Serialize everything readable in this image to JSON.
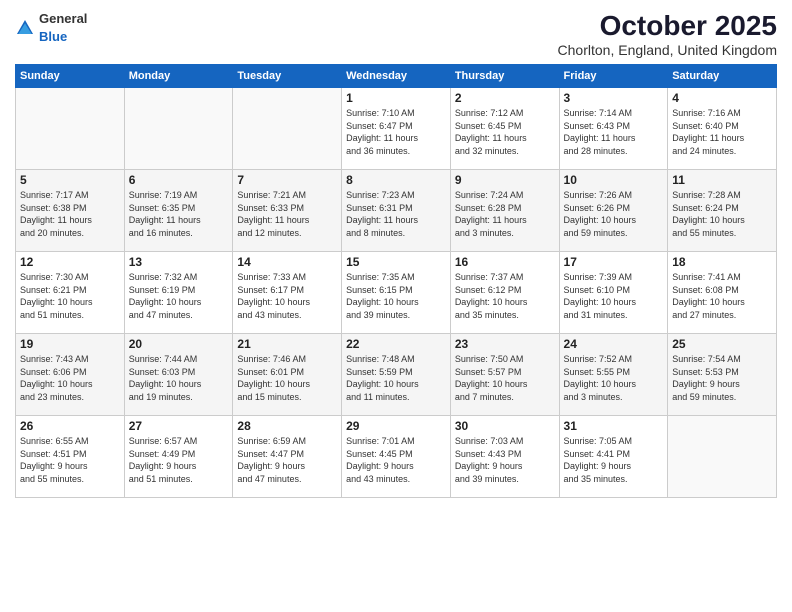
{
  "logo": {
    "general": "General",
    "blue": "Blue"
  },
  "header": {
    "month": "October 2025",
    "location": "Chorlton, England, United Kingdom"
  },
  "days_of_week": [
    "Sunday",
    "Monday",
    "Tuesday",
    "Wednesday",
    "Thursday",
    "Friday",
    "Saturday"
  ],
  "weeks": [
    [
      {
        "day": "",
        "info": ""
      },
      {
        "day": "",
        "info": ""
      },
      {
        "day": "",
        "info": ""
      },
      {
        "day": "1",
        "info": "Sunrise: 7:10 AM\nSunset: 6:47 PM\nDaylight: 11 hours\nand 36 minutes."
      },
      {
        "day": "2",
        "info": "Sunrise: 7:12 AM\nSunset: 6:45 PM\nDaylight: 11 hours\nand 32 minutes."
      },
      {
        "day": "3",
        "info": "Sunrise: 7:14 AM\nSunset: 6:43 PM\nDaylight: 11 hours\nand 28 minutes."
      },
      {
        "day": "4",
        "info": "Sunrise: 7:16 AM\nSunset: 6:40 PM\nDaylight: 11 hours\nand 24 minutes."
      }
    ],
    [
      {
        "day": "5",
        "info": "Sunrise: 7:17 AM\nSunset: 6:38 PM\nDaylight: 11 hours\nand 20 minutes."
      },
      {
        "day": "6",
        "info": "Sunrise: 7:19 AM\nSunset: 6:35 PM\nDaylight: 11 hours\nand 16 minutes."
      },
      {
        "day": "7",
        "info": "Sunrise: 7:21 AM\nSunset: 6:33 PM\nDaylight: 11 hours\nand 12 minutes."
      },
      {
        "day": "8",
        "info": "Sunrise: 7:23 AM\nSunset: 6:31 PM\nDaylight: 11 hours\nand 8 minutes."
      },
      {
        "day": "9",
        "info": "Sunrise: 7:24 AM\nSunset: 6:28 PM\nDaylight: 11 hours\nand 3 minutes."
      },
      {
        "day": "10",
        "info": "Sunrise: 7:26 AM\nSunset: 6:26 PM\nDaylight: 10 hours\nand 59 minutes."
      },
      {
        "day": "11",
        "info": "Sunrise: 7:28 AM\nSunset: 6:24 PM\nDaylight: 10 hours\nand 55 minutes."
      }
    ],
    [
      {
        "day": "12",
        "info": "Sunrise: 7:30 AM\nSunset: 6:21 PM\nDaylight: 10 hours\nand 51 minutes."
      },
      {
        "day": "13",
        "info": "Sunrise: 7:32 AM\nSunset: 6:19 PM\nDaylight: 10 hours\nand 47 minutes."
      },
      {
        "day": "14",
        "info": "Sunrise: 7:33 AM\nSunset: 6:17 PM\nDaylight: 10 hours\nand 43 minutes."
      },
      {
        "day": "15",
        "info": "Sunrise: 7:35 AM\nSunset: 6:15 PM\nDaylight: 10 hours\nand 39 minutes."
      },
      {
        "day": "16",
        "info": "Sunrise: 7:37 AM\nSunset: 6:12 PM\nDaylight: 10 hours\nand 35 minutes."
      },
      {
        "day": "17",
        "info": "Sunrise: 7:39 AM\nSunset: 6:10 PM\nDaylight: 10 hours\nand 31 minutes."
      },
      {
        "day": "18",
        "info": "Sunrise: 7:41 AM\nSunset: 6:08 PM\nDaylight: 10 hours\nand 27 minutes."
      }
    ],
    [
      {
        "day": "19",
        "info": "Sunrise: 7:43 AM\nSunset: 6:06 PM\nDaylight: 10 hours\nand 23 minutes."
      },
      {
        "day": "20",
        "info": "Sunrise: 7:44 AM\nSunset: 6:03 PM\nDaylight: 10 hours\nand 19 minutes."
      },
      {
        "day": "21",
        "info": "Sunrise: 7:46 AM\nSunset: 6:01 PM\nDaylight: 10 hours\nand 15 minutes."
      },
      {
        "day": "22",
        "info": "Sunrise: 7:48 AM\nSunset: 5:59 PM\nDaylight: 10 hours\nand 11 minutes."
      },
      {
        "day": "23",
        "info": "Sunrise: 7:50 AM\nSunset: 5:57 PM\nDaylight: 10 hours\nand 7 minutes."
      },
      {
        "day": "24",
        "info": "Sunrise: 7:52 AM\nSunset: 5:55 PM\nDaylight: 10 hours\nand 3 minutes."
      },
      {
        "day": "25",
        "info": "Sunrise: 7:54 AM\nSunset: 5:53 PM\nDaylight: 9 hours\nand 59 minutes."
      }
    ],
    [
      {
        "day": "26",
        "info": "Sunrise: 6:55 AM\nSunset: 4:51 PM\nDaylight: 9 hours\nand 55 minutes."
      },
      {
        "day": "27",
        "info": "Sunrise: 6:57 AM\nSunset: 4:49 PM\nDaylight: 9 hours\nand 51 minutes."
      },
      {
        "day": "28",
        "info": "Sunrise: 6:59 AM\nSunset: 4:47 PM\nDaylight: 9 hours\nand 47 minutes."
      },
      {
        "day": "29",
        "info": "Sunrise: 7:01 AM\nSunset: 4:45 PM\nDaylight: 9 hours\nand 43 minutes."
      },
      {
        "day": "30",
        "info": "Sunrise: 7:03 AM\nSunset: 4:43 PM\nDaylight: 9 hours\nand 39 minutes."
      },
      {
        "day": "31",
        "info": "Sunrise: 7:05 AM\nSunset: 4:41 PM\nDaylight: 9 hours\nand 35 minutes."
      },
      {
        "day": "",
        "info": ""
      }
    ]
  ]
}
